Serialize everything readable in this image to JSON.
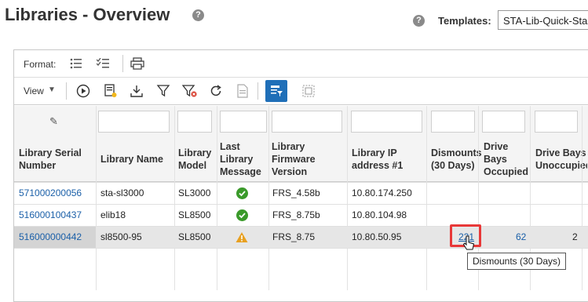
{
  "header": {
    "title": "Libraries - Overview",
    "templates_label": "Templates:",
    "templates_value": "STA-Lib-Quick-Start"
  },
  "toolbar": {
    "format_label": "Format:",
    "view_label": "View"
  },
  "table": {
    "columns": [
      "Library Serial Number",
      "Library Name",
      "Library Model",
      "Last Library Message",
      "Library Firmware Version",
      "Library IP address #1",
      "Dismounts (30 Days)",
      "Drive Bays Occupied",
      "Drive Bays Unoccupied"
    ],
    "rows": [
      {
        "serial": "571000200056",
        "name": "sta-sl3000",
        "model": "SL3000",
        "status": "ok",
        "firmware": "FRS_4.58b",
        "ip": "10.80.174.250",
        "dismounts": "",
        "occupied": "",
        "unoccupied": ""
      },
      {
        "serial": "516000100437",
        "name": "elib18",
        "model": "SL8500",
        "status": "ok",
        "firmware": "FRS_8.75b",
        "ip": "10.80.104.98",
        "dismounts": "",
        "occupied": "",
        "unoccupied": ""
      },
      {
        "serial": "516000000442",
        "name": "sl8500-95",
        "model": "SL8500",
        "status": "warning",
        "firmware": "FRS_8.75",
        "ip": "10.80.50.95",
        "dismounts": "221",
        "occupied": "62",
        "unoccupied": "2"
      }
    ]
  },
  "tooltip": "Dismounts (30 Days)",
  "colors": {
    "link": "#1a5fa8",
    "ok": "#3a9a2a",
    "warning": "#e8a020",
    "highlight": "#e83838"
  }
}
